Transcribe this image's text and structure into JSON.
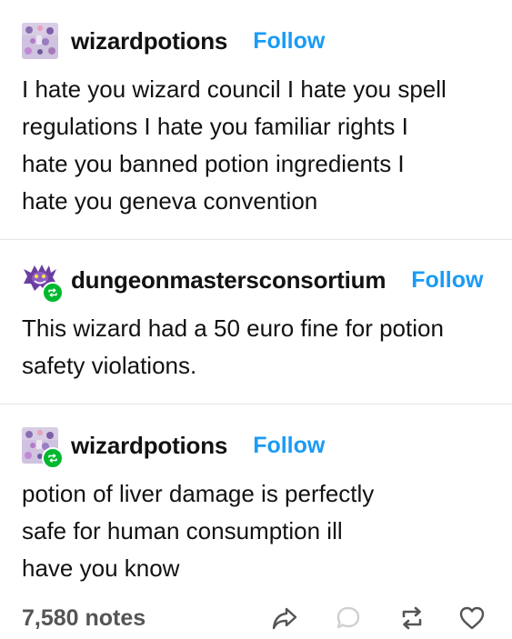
{
  "posts": [
    {
      "username": "wizardpotions",
      "follow_label": "Follow",
      "avatar_icon": "wizard-collage-avatar",
      "reblogged": false,
      "text": "I hate you wizard council I hate you spell\nregulations I hate you familiar rights I\nhate you banned potion ingredients I\nhate you geneva convention"
    },
    {
      "username": "dungeonmastersconsortium",
      "follow_label": "Follow",
      "avatar_icon": "purple-monster-avatar",
      "reblogged": true,
      "text": "This wizard had a 50 euro fine for potion\nsafety violations."
    },
    {
      "username": "wizardpotions",
      "follow_label": "Follow",
      "avatar_icon": "wizard-collage-avatar",
      "reblogged": true,
      "text": "potion of liver damage is perfectly\nsafe for human consumption ill\nhave you know"
    }
  ],
  "footer": {
    "notes": "7,580 notes",
    "actions": [
      "share-icon",
      "reply-icon",
      "reblog-icon",
      "like-icon"
    ]
  },
  "colors": {
    "follow": "#1a9bf5",
    "reblog_badge": "#00b82e",
    "divider": "#e6e6e6",
    "notes": "#555555"
  }
}
